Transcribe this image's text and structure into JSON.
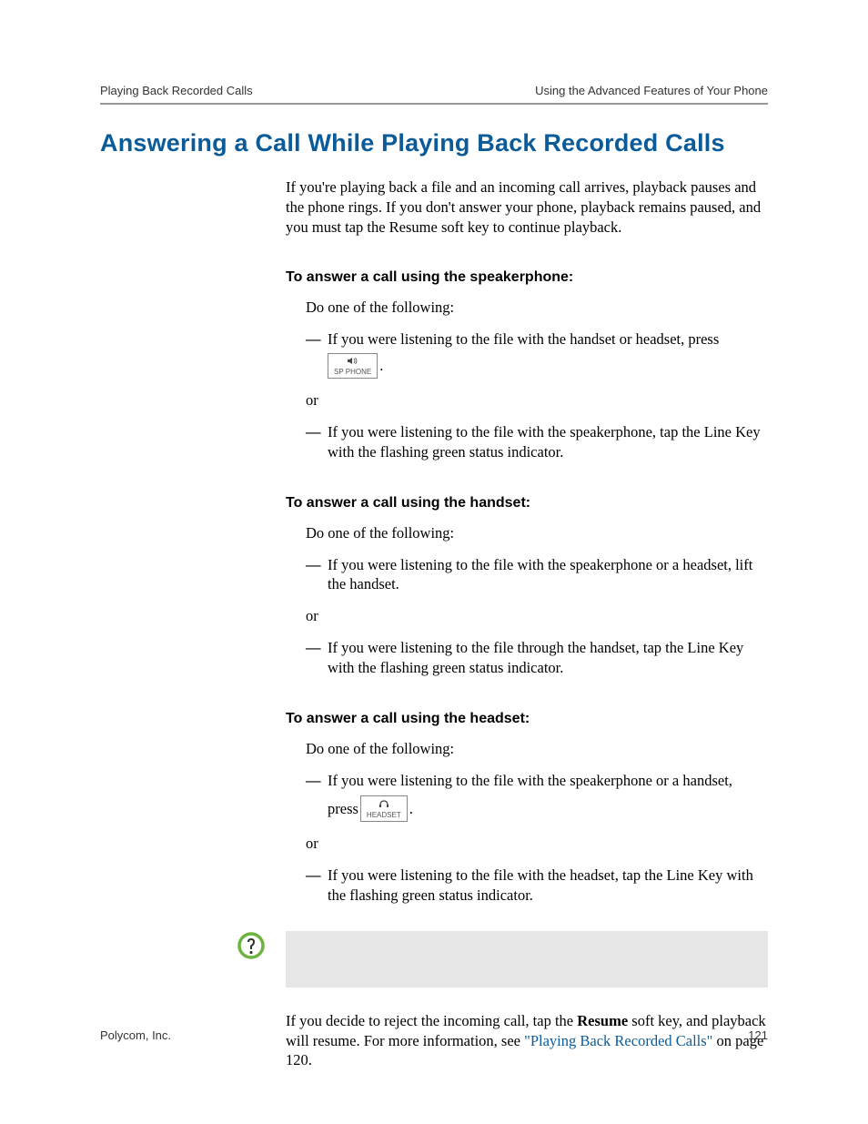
{
  "header": {
    "left": "Playing Back Recorded Calls",
    "right": "Using the Advanced Features of Your Phone"
  },
  "title": "Answering a Call While Playing Back Recorded Calls",
  "intro": "If you're playing back a file and an incoming call arrives, playback pauses and the phone rings. If you don't answer your phone, playback remains paused, and you must tap the Resume soft key to continue playback.",
  "sec1": {
    "heading": "To answer a call using the speakerphone:",
    "do": "Do one of the following:",
    "b1a": "If you were listening to the file with the handset or headset, press ",
    "key1_label": "SP PHONE",
    "b1b": ".",
    "or": "or",
    "b2": "If you were listening to the file with the speakerphone, tap the Line Key with the flashing green status indicator."
  },
  "sec2": {
    "heading": "To answer a call using the handset:",
    "do": "Do one of the following:",
    "b1": "If you were listening to the file with the speakerphone or a headset, lift the handset.",
    "or": "or",
    "b2": "If you were listening to the file through the handset, tap the Line Key with the flashing green status indicator."
  },
  "sec3": {
    "heading": "To answer a call using the headset:",
    "do": "Do one of the following:",
    "b1a": "If you were listening to the file with the speakerphone or a handset, ",
    "b1b": "press ",
    "key3_label": "HEADSET",
    "b1c": ".",
    "or": "or",
    "b2": "If you were listening to the file with the headset, tap the Line Key with the flashing green status indicator."
  },
  "final": {
    "t1": "If you decide to reject the incoming call, tap the ",
    "bold": "Resume",
    "t2": " soft key, and playback will resume. For more information, see ",
    "link": "\"Playing Back Recorded Calls\"",
    "t3": " on page 120."
  },
  "footer": {
    "left": "Polycom, Inc.",
    "right": "121"
  }
}
